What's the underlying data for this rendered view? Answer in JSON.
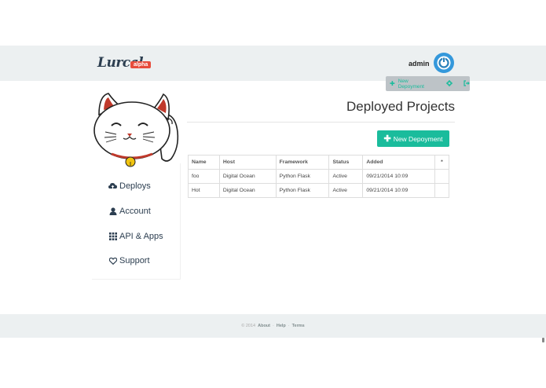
{
  "brand": {
    "name": "Lurcal",
    "badge": "alpha"
  },
  "header": {
    "user": "admin"
  },
  "subbar": {
    "new_label": "New Depoyment"
  },
  "sidebar": {
    "items": [
      {
        "label": "Deploys",
        "icon": "cloud-upload-icon"
      },
      {
        "label": "Account",
        "icon": "user-icon"
      },
      {
        "label": "API & Apps",
        "icon": "grid-icon"
      },
      {
        "label": "Support",
        "icon": "heart-icon"
      }
    ]
  },
  "main": {
    "title": "Deployed Projects",
    "new_button": "New Depoyment",
    "table": {
      "headers": [
        "Name",
        "Host",
        "Framework",
        "Status",
        "Added",
        "*"
      ],
      "rows": [
        [
          "foo",
          "Digital Ocean",
          "Python Flask",
          "Active",
          "09/21/2014 10:09",
          ""
        ],
        [
          "Hot",
          "Digital Ocean",
          "Python Flask",
          "Active",
          "09/21/2014 10:09",
          ""
        ]
      ]
    }
  },
  "footer": {
    "copyright": "© 2014",
    "links": [
      "About",
      "Help",
      "Terms"
    ],
    "separator": "·"
  },
  "colors": {
    "accent": "#1abc9c",
    "primary": "#3498db",
    "bar": "#ecf0f1",
    "badge": "#e74c3c"
  }
}
